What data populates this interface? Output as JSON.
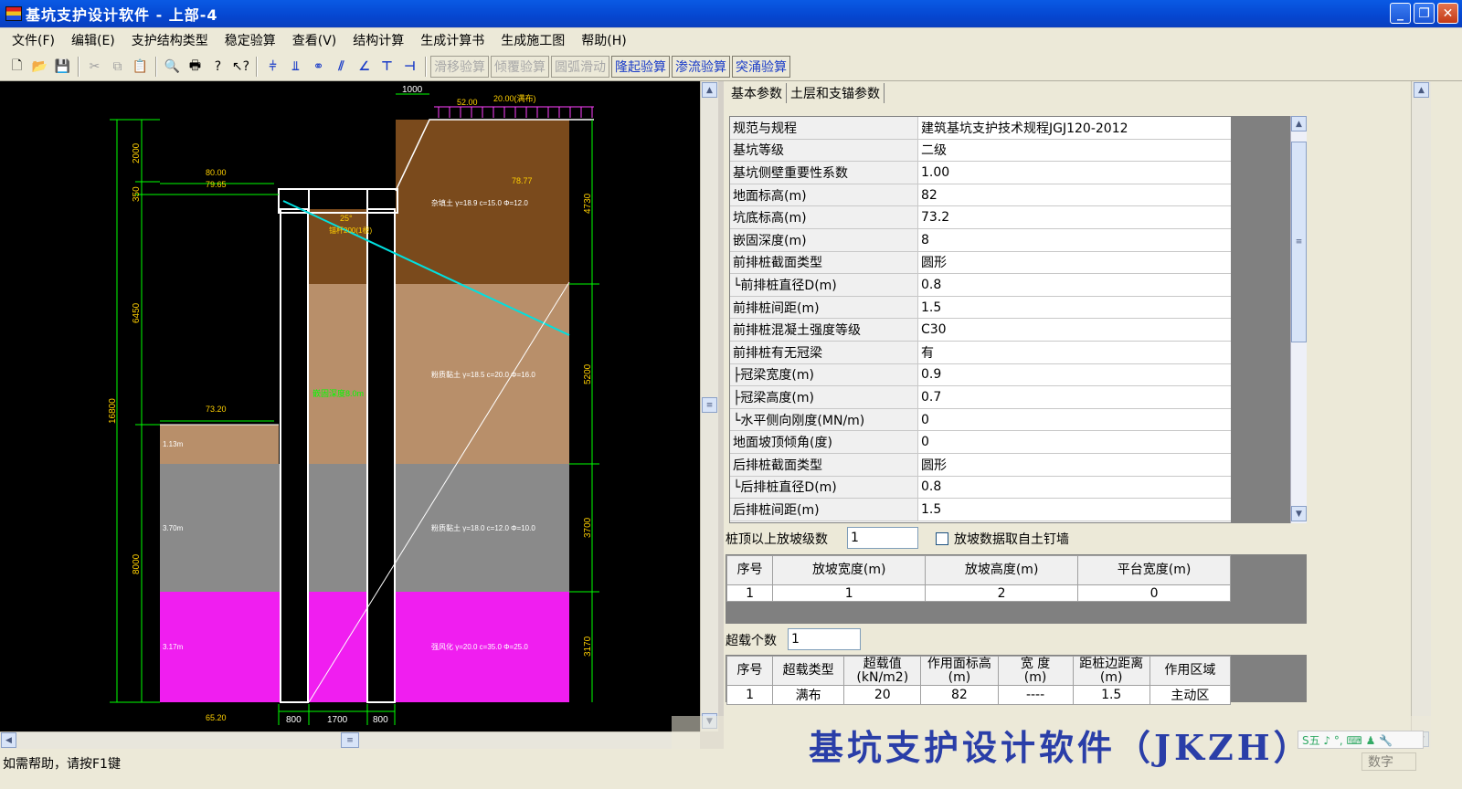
{
  "window": {
    "title": "基坑支护设计软件 - 上部-4"
  },
  "menu": [
    "文件(F)",
    "编辑(E)",
    "支护结构类型",
    "稳定验算",
    "查看(V)",
    "结构计算",
    "生成计算书",
    "生成施工图",
    "帮助(H)"
  ],
  "toolbar": {
    "text_buttons": [
      {
        "label": "滑移验算",
        "enabled": false
      },
      {
        "label": "倾覆验算",
        "enabled": false
      },
      {
        "label": "圆弧滑动",
        "enabled": false
      },
      {
        "label": "隆起验算",
        "enabled": true
      },
      {
        "label": "渗流验算",
        "enabled": true
      },
      {
        "label": "突涌验算",
        "enabled": true
      }
    ]
  },
  "drawing": {
    "dims_left": [
      "2000",
      "350",
      "6450",
      "16800",
      "8000"
    ],
    "dims_right": [
      "4730",
      "5200",
      "3700",
      "3170"
    ],
    "dims_bottom": [
      "800",
      "1700",
      "800"
    ],
    "dim_top": "1000",
    "surcharge": {
      "width": "52.00",
      "load": "20.00(满布)"
    },
    "elevations": {
      "ground_top": "80.00",
      "ground_sub": "79.65",
      "right_level": "78.77",
      "pit_bottom": "73.20",
      "pile_bottom": "65.20"
    },
    "anchor_angle": "25°",
    "anchor_label": "锚杆200(1根)",
    "inner_label": "嵌固深度8.0m",
    "layer_thick": [
      "1.13m",
      "3.70m",
      "3.17m"
    ],
    "layers": [
      {
        "name": "杂填土 γ=18.9 c=15.0 Φ=12.0",
        "color": "#7a4a1c"
      },
      {
        "name": "粉质黏土 γ=18.5 c=20.0 Φ=16.0",
        "color": "#b88f6a"
      },
      {
        "name": "粉质黏土 γ=18.0 c=12.0 Φ=10.0",
        "color": "#8a8a8a"
      },
      {
        "name": "强风化 γ=20.0 c=35.0 Φ=25.0",
        "color": "#f01ef0"
      }
    ]
  },
  "tabs": [
    "基本参数",
    "土层和支锚参数"
  ],
  "params": [
    {
      "label": "规范与规程",
      "value": "建筑基坑支护技术规程JGJ120-2012"
    },
    {
      "label": "基坑等级",
      "value": "二级"
    },
    {
      "label": "基坑侧壁重要性系数",
      "value": "1.00"
    },
    {
      "label": "地面标高(m)",
      "value": "82"
    },
    {
      "label": "坑底标高(m)",
      "value": "73.2"
    },
    {
      "label": "嵌固深度(m)",
      "value": "8"
    },
    {
      "label": "前排桩截面类型",
      "value": "圆形"
    },
    {
      "label": " └前排桩直径D(m)",
      "value": "0.8"
    },
    {
      "label": "前排桩间距(m)",
      "value": "1.5"
    },
    {
      "label": "前排桩混凝土强度等级",
      "value": "C30"
    },
    {
      "label": "前排桩有无冠梁",
      "value": "有"
    },
    {
      "label": " ├冠梁宽度(m)",
      "value": "0.9"
    },
    {
      "label": " ├冠梁高度(m)",
      "value": "0.7"
    },
    {
      "label": " └水平侧向刚度(MN/m)",
      "value": "0"
    },
    {
      "label": "地面坡顶倾角(度)",
      "value": "0"
    },
    {
      "label": "后排桩截面类型",
      "value": "圆形"
    },
    {
      "label": " └后排桩直径D(m)",
      "value": "0.8"
    },
    {
      "label": "后排桩间距(m)",
      "value": "1.5"
    }
  ],
  "slope": {
    "label": "桩顶以上放坡级数",
    "value": "1",
    "checkbox_label": "放坡数据取自土钉墙",
    "headers": [
      "序号",
      "放坡宽度(m)",
      "放坡高度(m)",
      "平台宽度(m)"
    ],
    "rows": [
      [
        "1",
        "1",
        "2",
        "0"
      ]
    ]
  },
  "surcharge_tbl": {
    "label": "超载个数",
    "value": "1",
    "headers": [
      "序号",
      "超载类型",
      "超载值\n(kN/m2)",
      "作用面标高\n(m)",
      "宽  度\n(m)",
      "距桩边距离\n(m)",
      "作用区域"
    ],
    "rows": [
      [
        "1",
        "满布",
        "20",
        "82",
        "----",
        "1.5",
        "主动区"
      ]
    ]
  },
  "status": {
    "help": "如需帮助，请按F1键",
    "mode": "数字"
  },
  "watermark": "基坑支护设计软件（JKZH）",
  "ime": "S五 ♪ °, ⌨ ♟ 🔧"
}
